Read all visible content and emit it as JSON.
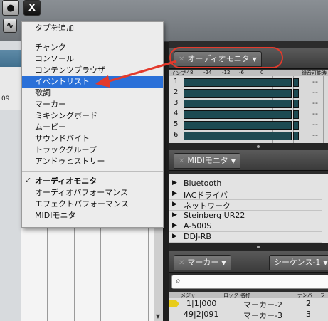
{
  "toolbar": {
    "close_glyph": "X"
  },
  "left_panel": {
    "ruler_label": "09"
  },
  "menu": {
    "items": [
      {
        "label": "タブを追加"
      },
      {
        "label": "チャンク"
      },
      {
        "label": "コンソール"
      },
      {
        "label": "コンテンツブラウザ"
      },
      {
        "label": "イベントリスト"
      },
      {
        "label": "歌詞"
      },
      {
        "label": "マーカー"
      },
      {
        "label": "ミキシングボード"
      },
      {
        "label": "ムービー"
      },
      {
        "label": "サウンドバイト"
      },
      {
        "label": "トラックグループ"
      },
      {
        "label": "アンドゥヒストリー"
      },
      {
        "label": "オーディオモニタ"
      },
      {
        "label": "オーディオパフォーマンス"
      },
      {
        "label": "エフェクトパフォーマンス"
      },
      {
        "label": "MIDIモニタ"
      }
    ],
    "highlighted": "イベントリスト",
    "checked": "オーディオモニタ",
    "check_glyph": "✓"
  },
  "audio_monitor": {
    "tab_label": "オーディオモニタ",
    "header": {
      "col_in": "インプ",
      "scale": [
        "-48",
        "-24",
        "-12",
        "-6",
        "0"
      ],
      "col_info": "録音可能時間"
    },
    "rows": [
      {
        "index": "1",
        "value": "--"
      },
      {
        "index": "2",
        "value": "--"
      },
      {
        "index": "3",
        "value": "--"
      },
      {
        "index": "4",
        "value": "--"
      },
      {
        "index": "5",
        "value": "--"
      },
      {
        "index": "6",
        "value": "--"
      }
    ]
  },
  "midi_monitor": {
    "tab_label": "MIDIモニタ",
    "devices": [
      "Bluetooth",
      "IACドライバ",
      "ネットワーク",
      "Steinberg UR22",
      "A-500S",
      "DDJ-RB"
    ]
  },
  "marker": {
    "tab_label": "マーカー",
    "tab2_label": "シーケンス-1",
    "header": {
      "col_measure": "メジャー",
      "col_lock": "ロック",
      "col_name": "名称",
      "col_number": "ナンバー",
      "col_extra": "フ"
    },
    "rows": [
      {
        "measure": "1|1|000",
        "name": "マーカー-2",
        "number": "2"
      },
      {
        "measure": "49|2|091",
        "name": "マーカー-3",
        "number": "3"
      }
    ]
  },
  "annotation": {
    "color": "#e33a2c"
  }
}
